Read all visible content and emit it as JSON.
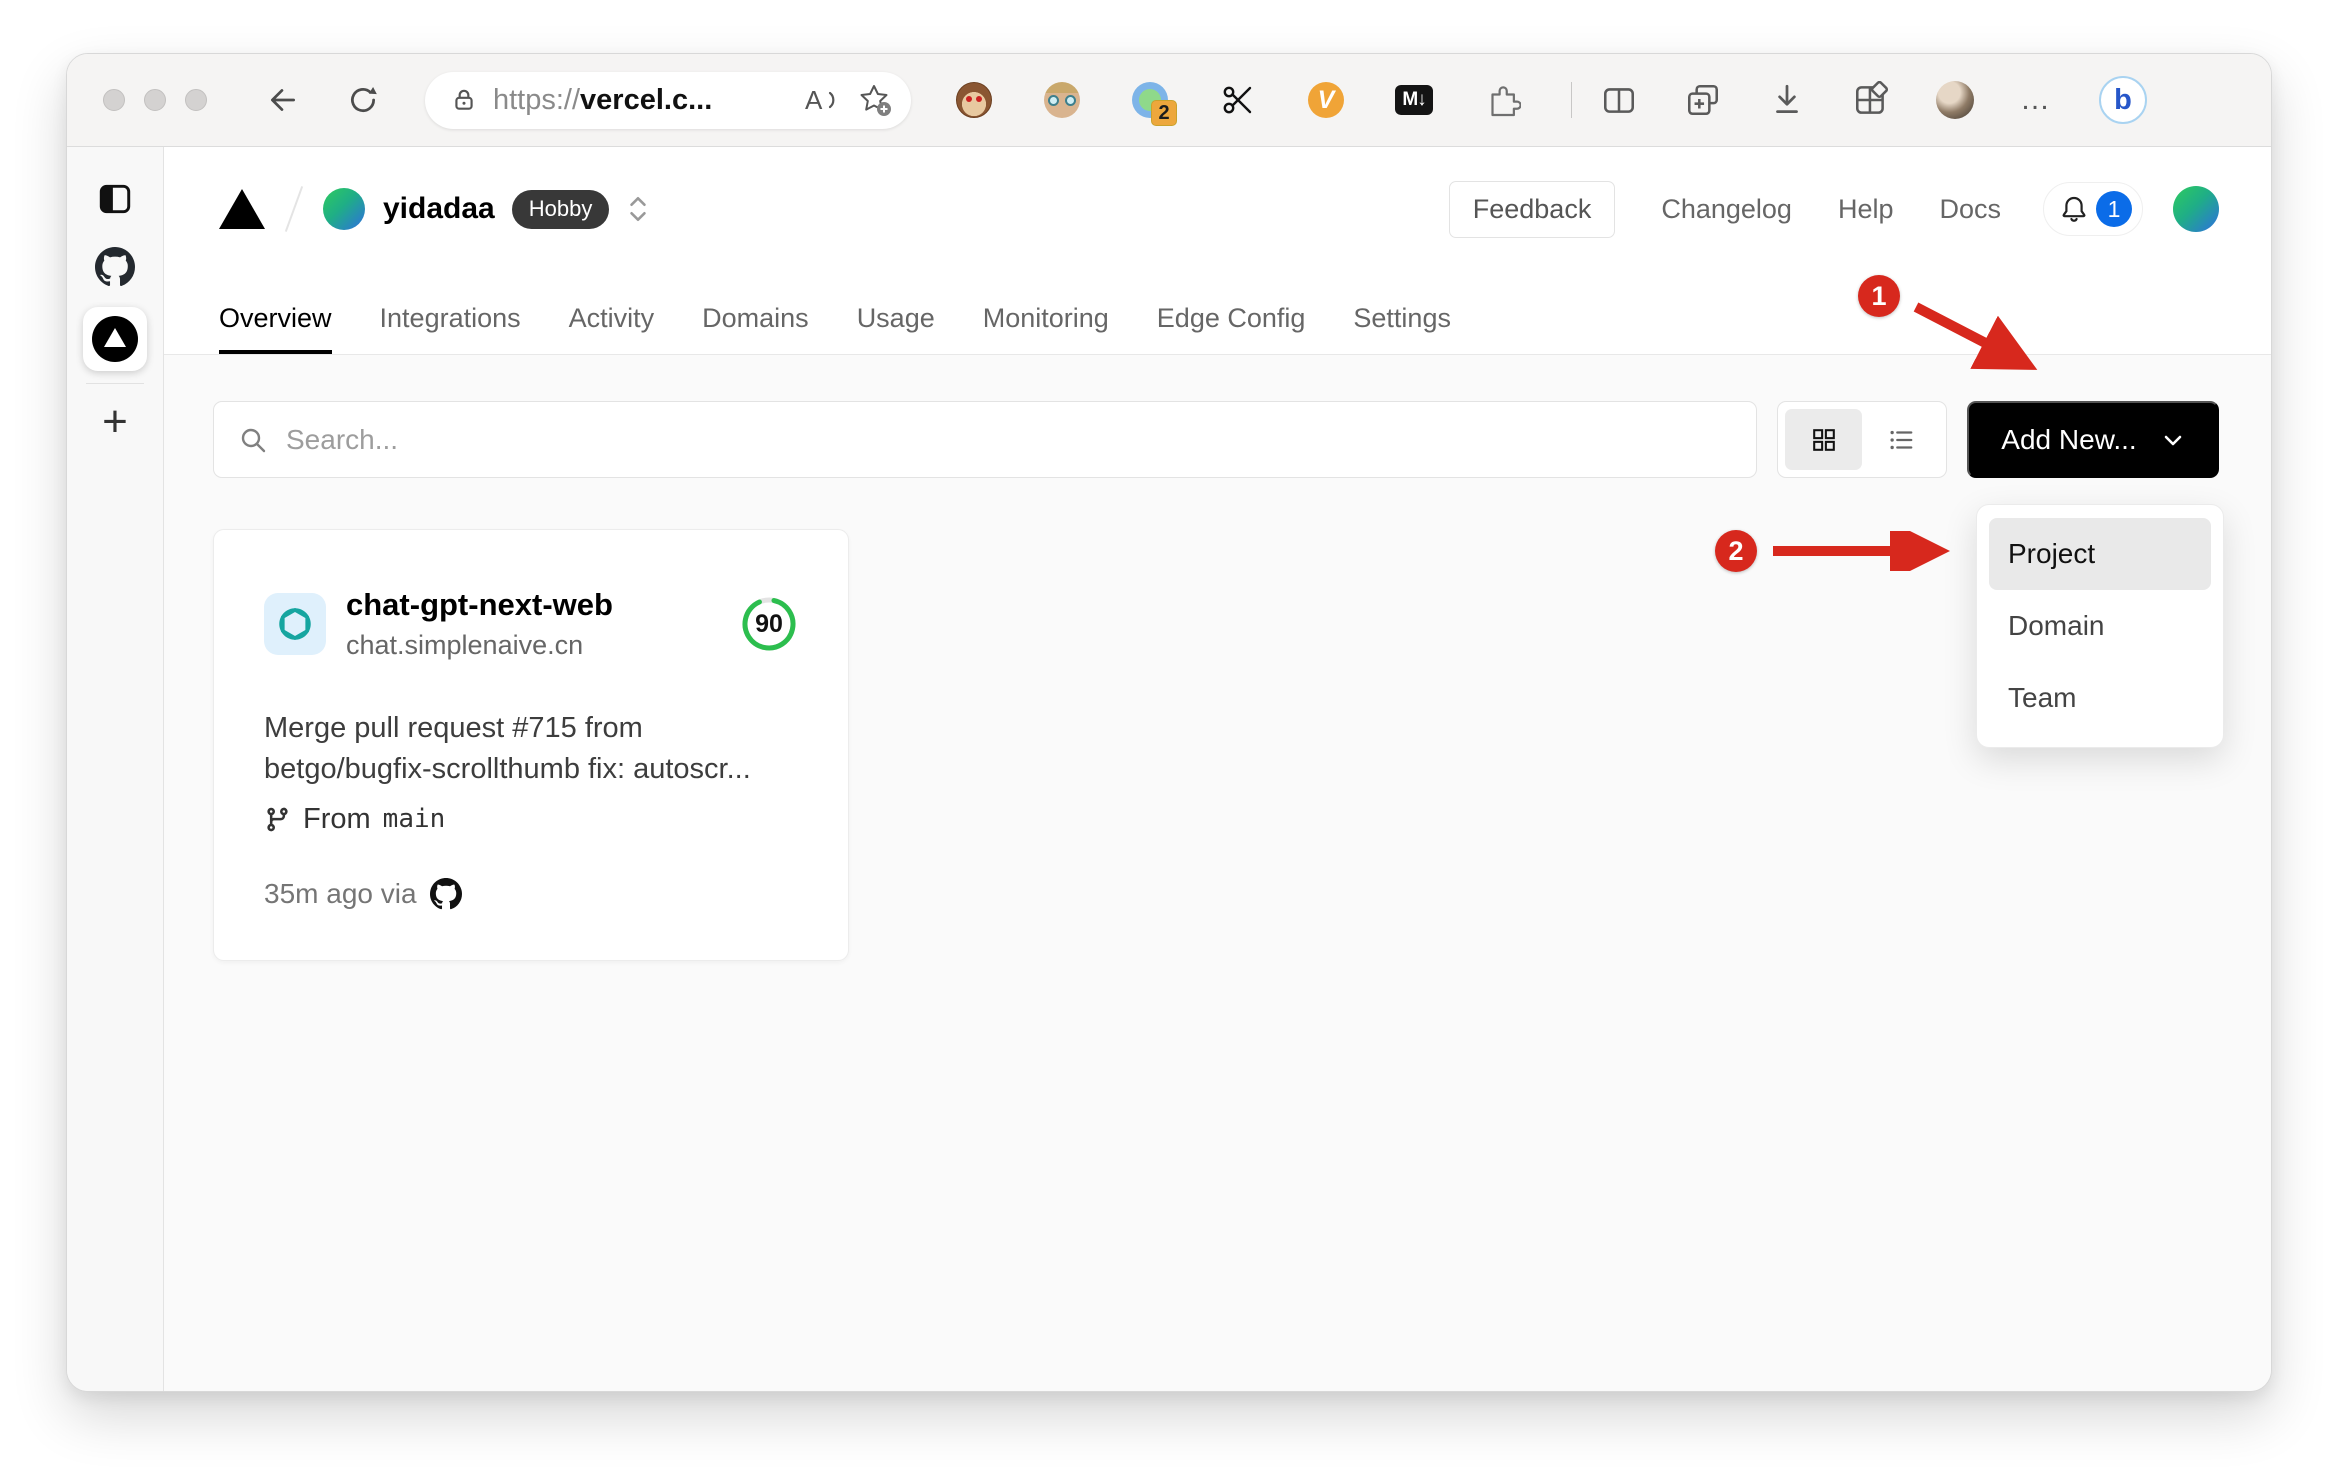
{
  "browser": {
    "url_scheme": "https://",
    "url_host": "vercel.c...",
    "ext_badge": "2",
    "v_ext_label": "V",
    "markdown_ext_label": "M↓",
    "bing_label": "b",
    "more_label": "…"
  },
  "header": {
    "account": "yidadaa",
    "plan": "Hobby",
    "feedback": "Feedback",
    "links": [
      "Changelog",
      "Help",
      "Docs"
    ],
    "notification_count": "1"
  },
  "tabs": [
    "Overview",
    "Integrations",
    "Activity",
    "Domains",
    "Usage",
    "Monitoring",
    "Edge Config",
    "Settings"
  ],
  "controls": {
    "search_placeholder": "Search...",
    "add_new": "Add New..."
  },
  "dropdown": {
    "items": [
      "Project",
      "Domain",
      "Team"
    ]
  },
  "card": {
    "name": "chat-gpt-next-web",
    "domain": "chat.simplenaive.cn",
    "score": "90",
    "commit_line1": "Merge pull request #715 from",
    "commit_line2": "betgo/bugfix-scrollthumb fix: autoscr...",
    "from_label": "From",
    "branch": "main",
    "meta": "35m ago via"
  },
  "annotations": {
    "step1": "1",
    "step2": "2",
    "arrow_color": "#d7281d"
  },
  "colors": {
    "ring_green": "#2cbe4e",
    "openai_teal": "#16a5a0",
    "badge_blue": "#0b6ce8",
    "add_new_bg": "#000000"
  }
}
